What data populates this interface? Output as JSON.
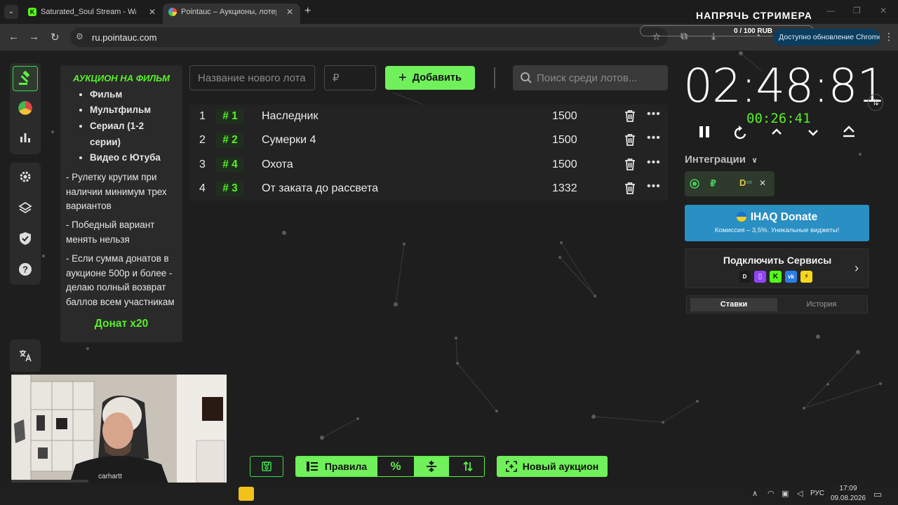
{
  "browser": {
    "tabs": [
      {
        "title": "Saturated_Soul Stream - Watch",
        "favicon": "kick-icon"
      },
      {
        "title": "Pointauc – Аукционы, лотереи",
        "favicon": "pointauc-icon",
        "active": true
      }
    ],
    "url": "ru.pointauc.com",
    "update_text": "Доступно обновление Chrome"
  },
  "stream_overlay": {
    "title": "НАПРЯЧЬ СТРИМЕРА",
    "goal": "0 / 100 RUB"
  },
  "rules": {
    "title": "АУКЦИОН НА ФИЛЬМ",
    "items": [
      "Фильм",
      "Мультфильм",
      "Сериал (1-2 серии)",
      "Видео с Ютуба"
    ],
    "paragraphs": [
      "- Рулетку крутим при наличии минимум трех вариантов",
      "- Победный вариант менять нельзя",
      "-  Если сумма донатов в аукционе 500р и более - делаю полный возврат баллов всем участникам"
    ],
    "donate": "Донат х20"
  },
  "inputs": {
    "lot_name_placeholder": "Название нового лота",
    "price_placeholder": "₽",
    "add_label": "Добавить",
    "search_placeholder": "Поиск среди лотов..."
  },
  "lots": [
    {
      "index": "1",
      "tag": "# 1",
      "name": "Наследник",
      "amount": "1500"
    },
    {
      "index": "2",
      "tag": "# 2",
      "name": "Сумерки 4",
      "amount": "1500"
    },
    {
      "index": "3",
      "tag": "# 4",
      "name": "Охота",
      "amount": "1500"
    },
    {
      "index": "4",
      "tag": "# 3",
      "name": "От заката до рассвета",
      "amount": "1332"
    }
  ],
  "timer": {
    "main": "02:48:81",
    "sub": "00:26:41"
  },
  "integrations": {
    "label": "Интеграции"
  },
  "ihaq": {
    "title": "IHAQ Donate",
    "subtitle": "Комиссия – 3,5%. Уникальные виджеты!"
  },
  "connect": {
    "title": "Подключить Сервисы"
  },
  "bets_tabs": [
    "Ставки",
    "История"
  ],
  "bottom_toolbar": {
    "rules_label": "Правила",
    "new_auction_label": "Новый аукцион"
  },
  "taskbar": {
    "lang": "РУС",
    "time": "17:09",
    "date": "09.08.2026"
  },
  "colors": {
    "accent": "#70f05a",
    "accent_text": "#58ef28",
    "ihaq": "#2a8fc2",
    "page_bg": "#1e1e1e"
  }
}
